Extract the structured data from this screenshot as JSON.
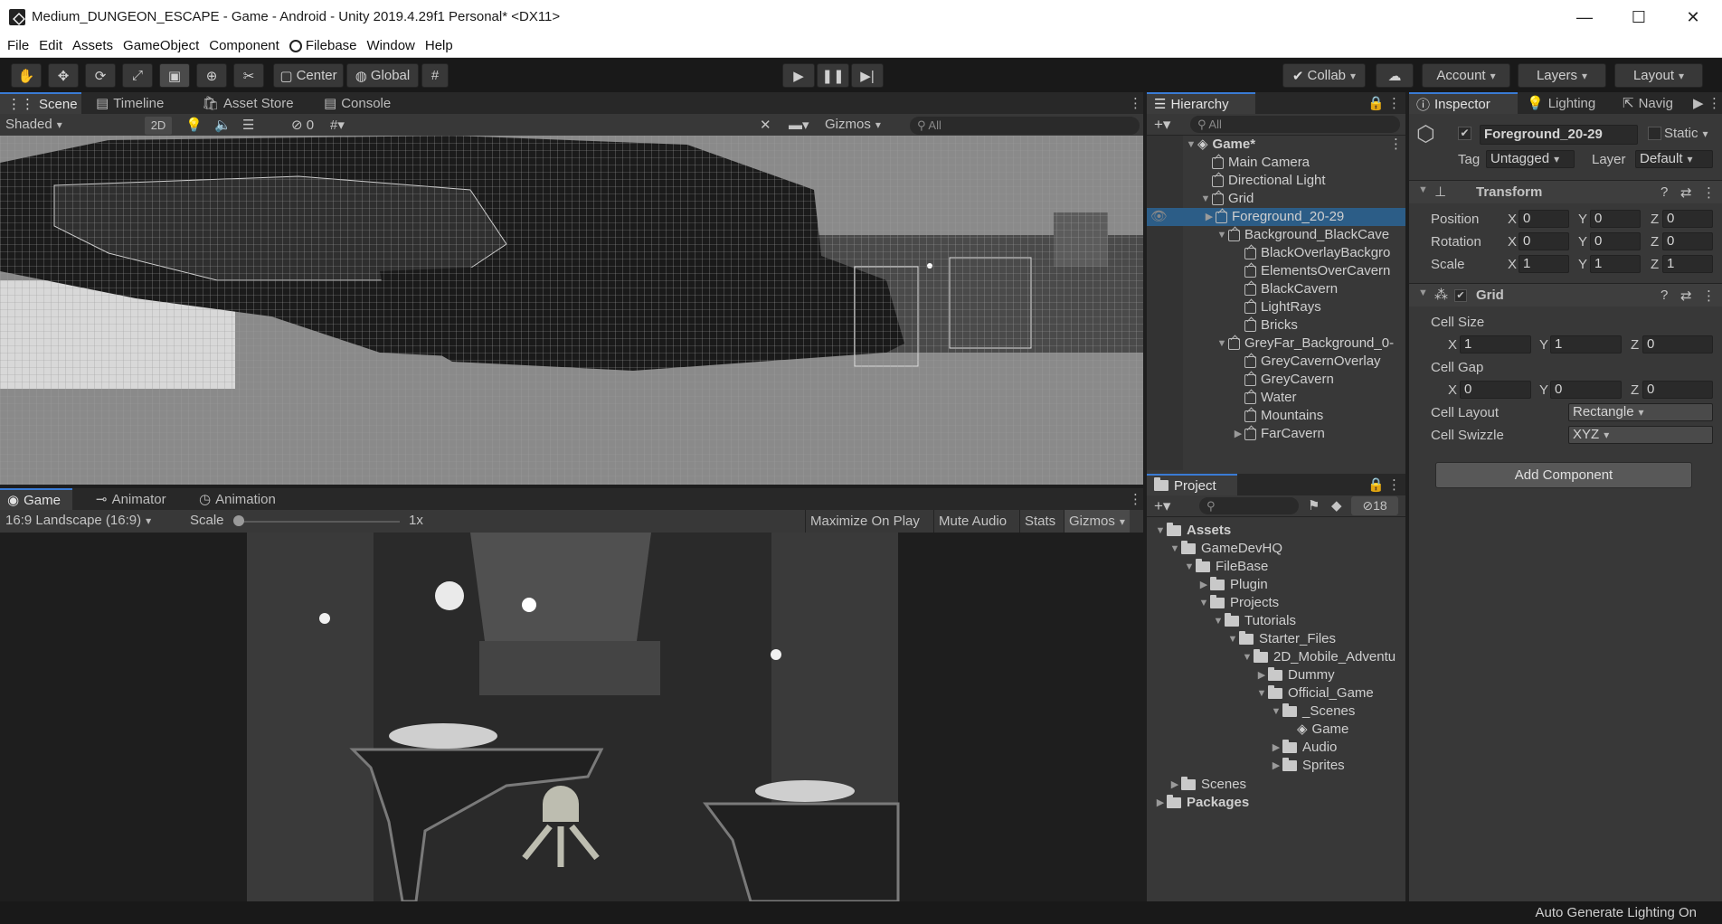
{
  "window": {
    "title": "Medium_DUNGEON_ESCAPE - Game - Android - Unity 2019.4.29f1 Personal* <DX11>",
    "minimize": "—",
    "maximize": "☐",
    "close": "✕"
  },
  "menu": [
    "File",
    "Edit",
    "Assets",
    "GameObject",
    "Component",
    "Filebase",
    "Window",
    "Help"
  ],
  "toolbar": {
    "center": "Center",
    "global": "Global",
    "collab": "Collab",
    "account": "Account",
    "layers": "Layers",
    "layout": "Layout"
  },
  "scene_tabs": [
    "Scene",
    "Timeline",
    "Asset Store",
    "Console"
  ],
  "scene_bar": {
    "shading": "Shaded",
    "mode2d": "2D",
    "hidden_count": "0",
    "gizmos": "Gizmos",
    "search_placeholder": "All"
  },
  "game_tabs": [
    "Game",
    "Animator",
    "Animation"
  ],
  "game_bar": {
    "aspect": "16:9 Landscape (16:9)",
    "scale_label": "Scale",
    "scale_value": "1x",
    "maximize_on_play": "Maximize On Play",
    "mute_audio": "Mute Audio",
    "stats": "Stats",
    "gizmos": "Gizmos"
  },
  "hierarchy": {
    "tab": "Hierarchy",
    "search_placeholder": "All",
    "scene_name": "Game*",
    "items": [
      {
        "label": "Main Camera",
        "depth": 1
      },
      {
        "label": "Directional Light",
        "depth": 1
      },
      {
        "label": "Grid",
        "depth": 1
      },
      {
        "label": "Foreground_20-29",
        "depth": 2
      },
      {
        "label": "Background_BlackCave",
        "depth": 2
      },
      {
        "label": "BlackOverlayBackgro",
        "depth": 3
      },
      {
        "label": "ElementsOverCavern",
        "depth": 3
      },
      {
        "label": "BlackCavern",
        "depth": 3
      },
      {
        "label": "LightRays",
        "depth": 3
      },
      {
        "label": "Bricks",
        "depth": 3
      },
      {
        "label": "GreyFar_Background_0-",
        "depth": 2
      },
      {
        "label": "GreyCavernOverlay",
        "depth": 3
      },
      {
        "label": "GreyCavern",
        "depth": 3
      },
      {
        "label": "Water",
        "depth": 3
      },
      {
        "label": "Mountains",
        "depth": 3
      },
      {
        "label": "FarCavern",
        "depth": 3
      }
    ]
  },
  "project": {
    "tab": "Project",
    "hidden_count": "18",
    "items": [
      {
        "label": "Assets"
      },
      {
        "label": "GameDevHQ"
      },
      {
        "label": "FileBase"
      },
      {
        "label": "Plugin"
      },
      {
        "label": "Projects"
      },
      {
        "label": "Tutorials"
      },
      {
        "label": "Starter_Files"
      },
      {
        "label": "2D_Mobile_Adventu"
      },
      {
        "label": "Dummy"
      },
      {
        "label": "Official_Game"
      },
      {
        "label": "_Scenes"
      },
      {
        "label": "Game"
      },
      {
        "label": "Audio"
      },
      {
        "label": "Sprites"
      },
      {
        "label": "Scenes"
      },
      {
        "label": "Packages"
      }
    ]
  },
  "inspector": {
    "tabs": [
      "Inspector",
      "Lighting",
      "Navig"
    ],
    "object_name": "Foreground_20-29",
    "static_label": "Static",
    "tag_label": "Tag",
    "tag_value": "Untagged",
    "layer_label": "Layer",
    "layer_value": "Default",
    "transform": {
      "title": "Transform",
      "position_label": "Position",
      "rotation_label": "Rotation",
      "scale_label": "Scale",
      "position": [
        "0",
        "0",
        "0"
      ],
      "rotation": [
        "0",
        "0",
        "0"
      ],
      "scale": [
        "1",
        "1",
        "1"
      ]
    },
    "grid": {
      "title": "Grid",
      "cell_size_label": "Cell Size",
      "cell_size": [
        "1",
        "1",
        "0"
      ],
      "cell_gap_label": "Cell Gap",
      "cell_gap": [
        "0",
        "0",
        "0"
      ],
      "cell_layout_label": "Cell Layout",
      "cell_layout": "Rectangle",
      "cell_swizzle_label": "Cell Swizzle",
      "cell_swizzle": "XYZ"
    },
    "add_component": "Add Component"
  },
  "axes": [
    "X",
    "Y",
    "Z"
  ],
  "status": {
    "text": "Auto Generate Lighting On"
  }
}
